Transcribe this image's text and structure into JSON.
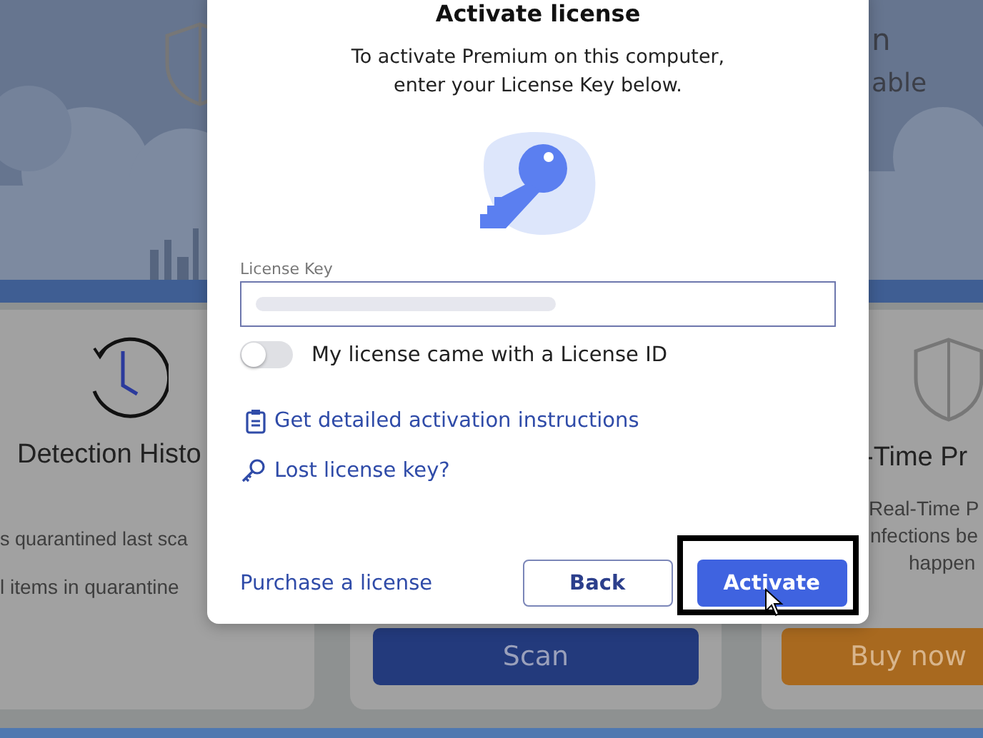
{
  "background": {
    "header_texts": [
      "n",
      "able"
    ],
    "cards": [
      {
        "kind": "history",
        "title": "Detection Histo",
        "lines": [
          "s quarantined last sca",
          "l items in quarantine"
        ]
      },
      {
        "kind": "scan",
        "button": "Scan"
      },
      {
        "kind": "protection",
        "title": "-Time Pr",
        "lines": [
          "Real-Time P",
          "nfections be",
          "happen"
        ],
        "button": "Buy now"
      }
    ]
  },
  "dialog": {
    "title": "Activate license",
    "message": "To activate Premium on this computer,\nenter your License Key below.",
    "license_key": {
      "label": "License Key"
    },
    "license_id_toggle": {
      "label": "My license came with a License ID",
      "on": false
    },
    "links": [
      {
        "kind": "instructions",
        "label": "Get detailed activation instructions"
      },
      {
        "kind": "lost_key",
        "label": "Lost license key?"
      }
    ],
    "purchase_link": "Purchase a license",
    "buttons": [
      {
        "kind": "secondary",
        "label": "Back",
        "highlighted": false
      },
      {
        "kind": "primary",
        "label": "Activate",
        "highlighted": true
      }
    ]
  }
}
